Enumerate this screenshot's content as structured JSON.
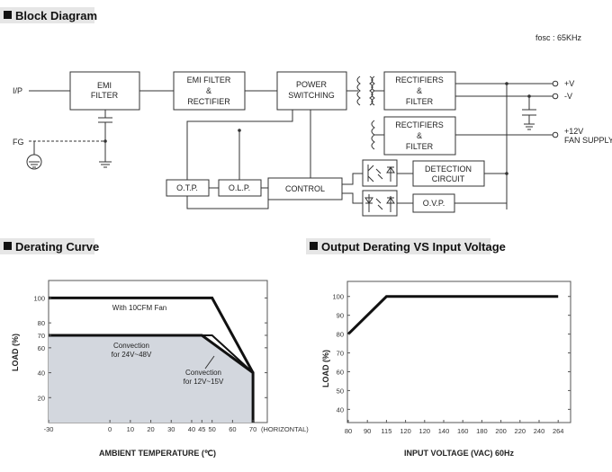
{
  "sections": {
    "block_diagram": "Block Diagram",
    "derating_curve": "Derating Curve",
    "output_derating": "Output Derating VS Input Voltage"
  },
  "block_diagram": {
    "fosc": "fosc : 65KHz",
    "input_label": "I/P",
    "fg_label": "FG",
    "emi_filter": [
      "EMI",
      "FILTER"
    ],
    "emi_rectifier": [
      "EMI FILTER",
      "&",
      "RECTIFIER"
    ],
    "power_switching": [
      "POWER",
      "SWITCHING"
    ],
    "rectifiers_1": [
      "RECTIFIERS",
      "&",
      "FILTER"
    ],
    "rectifiers_2": [
      "RECTIFIERS",
      "&",
      "FILTER"
    ],
    "detection": [
      "DETECTION",
      "CIRCUIT"
    ],
    "ovp": "O.V.P.",
    "otp": "O.T.P.",
    "olp": "O.L.P.",
    "control": "CONTROL",
    "out_pos": "+V",
    "out_neg": "-V",
    "out_12v": "+12V",
    "fan_supply": "FAN SUPPLY"
  },
  "chart_data": [
    {
      "type": "line",
      "xlabel": "AMBIENT TEMPERATURE (℃)",
      "ylabel": "LOAD (%)",
      "x_ticks": [
        -30,
        0,
        10,
        20,
        30,
        40,
        45,
        50,
        60,
        70
      ],
      "x_tick_suffix": "(HORIZONTAL)",
      "y_ticks": [
        20,
        40,
        60,
        70,
        80,
        100
      ],
      "xlim": [
        -30,
        77
      ],
      "ylim": [
        0,
        114
      ],
      "grid": false,
      "series": [
        {
          "name": "With 10CFM Fan",
          "points": [
            [
              -30,
              100
            ],
            [
              50,
              100
            ],
            [
              70,
              40
            ]
          ]
        },
        {
          "name": "Convection for 24V~48V",
          "points": [
            [
              -30,
              70
            ],
            [
              45,
              70
            ],
            [
              70,
              40
            ],
            [
              70,
              0
            ]
          ],
          "filled": true,
          "fill_color": "#d3d7de"
        },
        {
          "name": "Convection for 12V~15V",
          "points": [
            [
              -30,
              70
            ],
            [
              50,
              70
            ],
            [
              70,
              40
            ]
          ]
        }
      ],
      "annotations": [
        "With 10CFM Fan",
        "Convection",
        "for 24V~48V",
        "Convection",
        "for 12V~15V"
      ]
    },
    {
      "type": "line",
      "xlabel": "INPUT VOLTAGE (VAC) 60Hz",
      "ylabel": "LOAD (%)",
      "x_ticks": [
        "80",
        "90",
        "115",
        "120",
        "120",
        "140",
        "160",
        "180",
        "200",
        "220",
        "240",
        "264"
      ],
      "y_ticks": [
        40,
        50,
        60,
        70,
        80,
        90,
        100
      ],
      "ylim": [
        33,
        108
      ],
      "grid": false,
      "series": [
        {
          "points": [
            [
              80,
              80
            ],
            [
              115,
              100
            ],
            [
              264,
              100
            ]
          ]
        }
      ]
    }
  ]
}
